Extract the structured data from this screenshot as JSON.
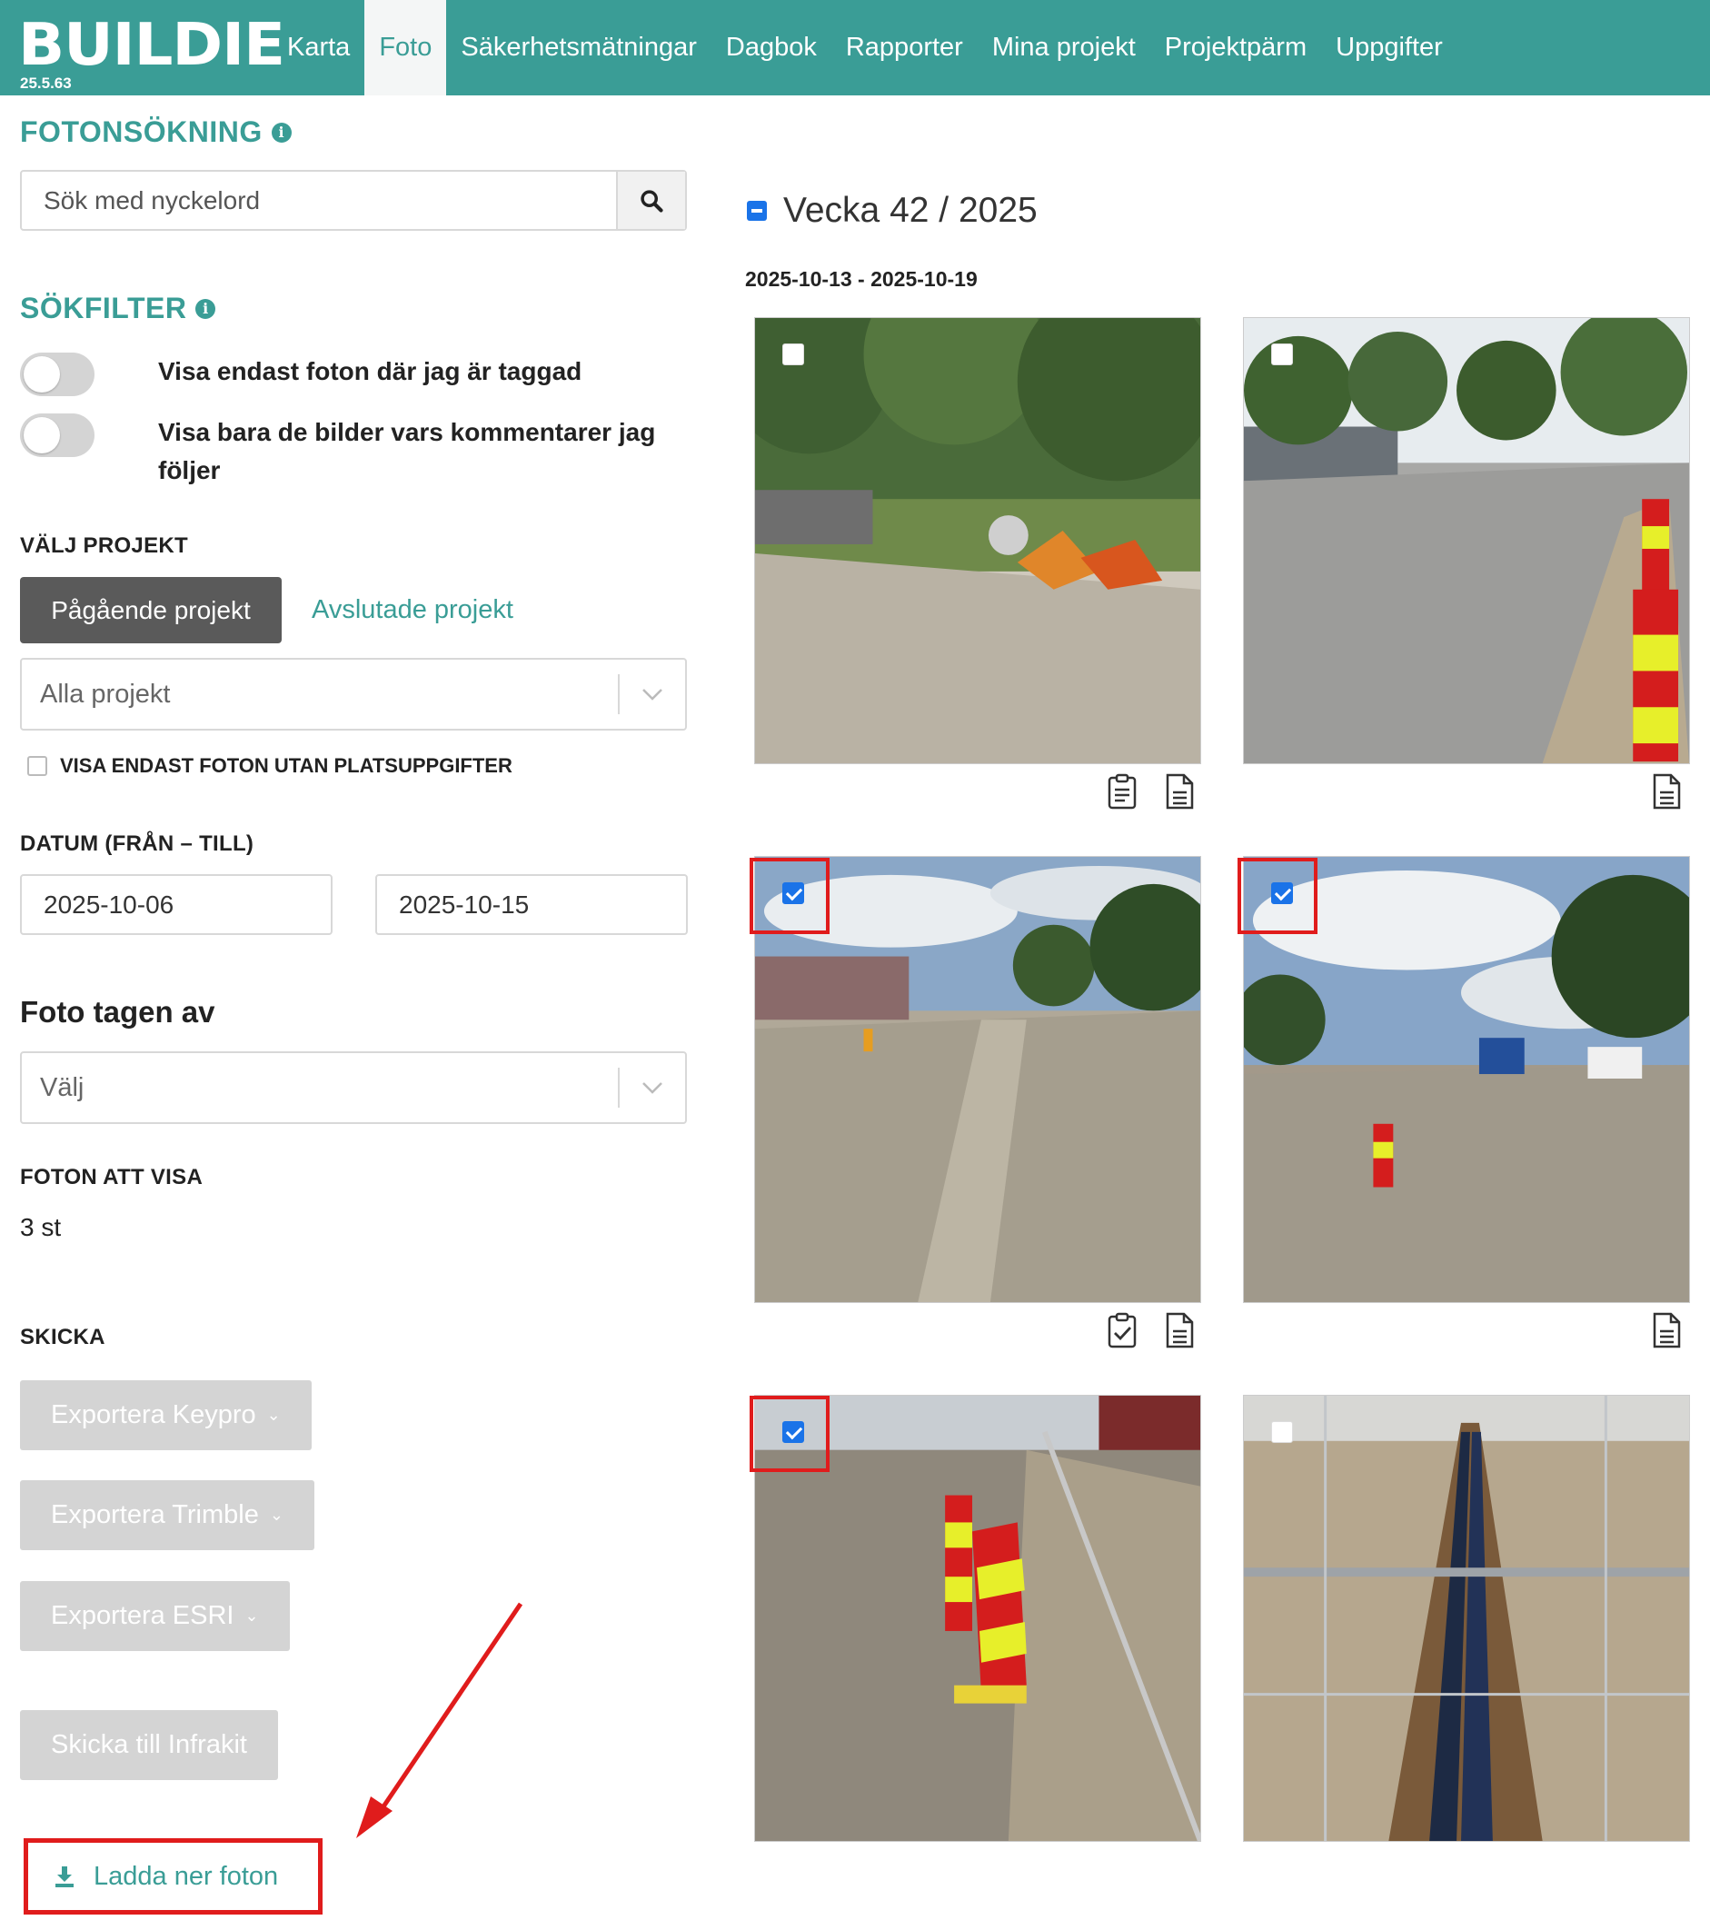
{
  "app": {
    "logo": "BUILDIE",
    "version": "25.5.63"
  },
  "nav": {
    "items": [
      {
        "label": "Karta",
        "active": false
      },
      {
        "label": "Foto",
        "active": true
      },
      {
        "label": "Säkerhetsmätningar",
        "active": false
      },
      {
        "label": "Dagbok",
        "active": false
      },
      {
        "label": "Rapporter",
        "active": false
      },
      {
        "label": "Mina projekt",
        "active": false
      },
      {
        "label": "Projektpärm",
        "active": false
      },
      {
        "label": "Uppgifter",
        "active": false
      }
    ]
  },
  "search": {
    "title": "FOTONSÖKNING",
    "placeholder": "Sök med nyckelord",
    "icon": "search-icon"
  },
  "filters": {
    "title": "SÖKFILTER",
    "toggle_tagged": {
      "label": "Visa endast foton där jag är taggad",
      "on": false
    },
    "toggle_followed": {
      "label": "Visa bara de bilder vars kommentarer jag följer",
      "on": false
    },
    "project": {
      "label": "VÄLJ PROJEKT",
      "ongoing": "Pågående projekt",
      "finished": "Avslutade projekt",
      "select_value": "Alla projekt"
    },
    "no_location": {
      "label": "VISA ENDAST FOTON UTAN PLATSUPPGIFTER",
      "checked": false
    },
    "dates": {
      "label": "DATUM (FRÅN – TILL)",
      "from": "2025-10-06",
      "to": "2025-10-15"
    },
    "taken_by": {
      "label": "Foto tagen av",
      "select_value": "Välj"
    },
    "photos_to_show": {
      "label": "FOTON ATT VISA",
      "value": "3 st"
    }
  },
  "send": {
    "label": "SKICKA",
    "export_keypro": "Exportera Keypro",
    "export_trimble": "Exportera Trimble",
    "export_esri": "Exportera ESRI",
    "send_infrakit": "Skicka till Infrakit",
    "download": "Ladda ner foton"
  },
  "week": {
    "title": "Vecka 42 / 2025",
    "range": "2025-10-13 - 2025-10-19",
    "photos": [
      {
        "checked": false,
        "highlighted": false,
        "icons": [
          "clipboard-icon",
          "document-icon"
        ]
      },
      {
        "checked": false,
        "highlighted": false,
        "icons": [
          "document-icon"
        ]
      },
      {
        "checked": true,
        "highlighted": true,
        "icons": [
          "clipboard-check-icon",
          "document-icon"
        ]
      },
      {
        "checked": true,
        "highlighted": true,
        "icons": [
          "document-icon"
        ]
      },
      {
        "checked": true,
        "highlighted": true,
        "icons": []
      },
      {
        "checked": false,
        "highlighted": false,
        "icons": []
      }
    ]
  },
  "colors": {
    "brand": "#3a9d96",
    "highlight": "#e01c1c",
    "checkbox": "#1a73e8"
  }
}
